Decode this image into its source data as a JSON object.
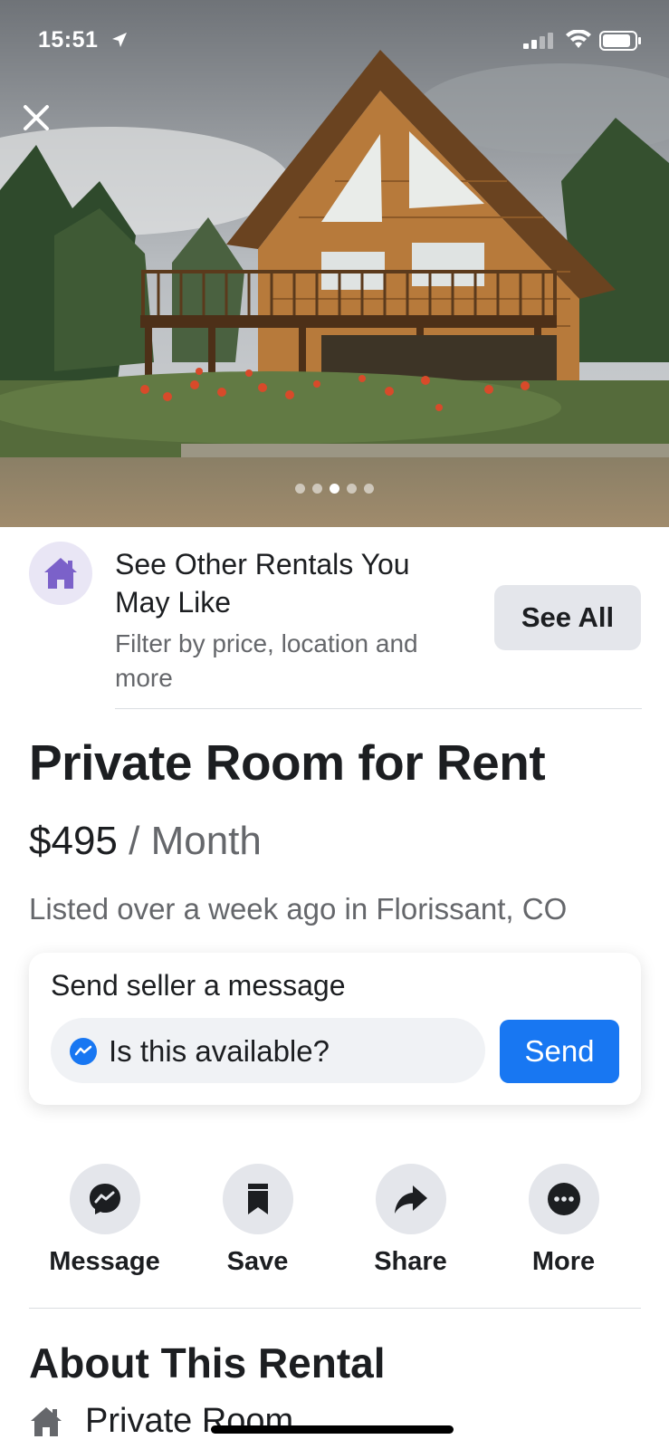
{
  "status_bar": {
    "time": "15:51"
  },
  "hero": {
    "image_description_icon": "log-cabin-photo",
    "pages": 5,
    "active_page": 3
  },
  "recommendation": {
    "title_line1": "See Other Rentals You",
    "title_line2": "May Like",
    "subtitle_line1": "Filter by price, location and",
    "subtitle_line2": "more",
    "button": "See All"
  },
  "listing": {
    "title": "Private Room for Rent",
    "price": "$495",
    "period": "/ Month",
    "listed": "Listed over a week ago in Florissant, CO"
  },
  "message": {
    "label": "Send seller a message",
    "input_value": "Is this available?",
    "send": "Send"
  },
  "actions": [
    {
      "label": "Message",
      "icon": "messenger-icon"
    },
    {
      "label": "Save",
      "icon": "bookmark-icon"
    },
    {
      "label": "Share",
      "icon": "share-icon"
    },
    {
      "label": "More",
      "icon": "more-icon"
    }
  ],
  "about": {
    "title": "About This Rental",
    "type": "Private Room"
  },
  "colors": {
    "accent": "#1877f2",
    "purple": "#7b61c9"
  }
}
